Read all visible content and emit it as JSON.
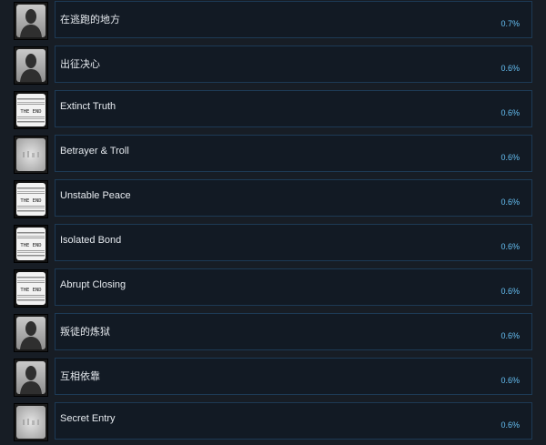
{
  "achievements": [
    {
      "name": "在逃跑的地方",
      "percent": "0.7%",
      "icon": "silhouette-icon"
    },
    {
      "name": "出征决心",
      "percent": "0.6%",
      "icon": "silhouette-icon"
    },
    {
      "name": "Extinct Truth",
      "percent": "0.6%",
      "icon": "the-end-icon",
      "icon_text": "THE END"
    },
    {
      "name": "Betrayer & Troll",
      "percent": "0.6%",
      "icon": "blurred-grey-icon"
    },
    {
      "name": "Unstable Peace",
      "percent": "0.6%",
      "icon": "the-end-icon",
      "icon_text": "THE END"
    },
    {
      "name": "Isolated Bond",
      "percent": "0.6%",
      "icon": "the-end-icon",
      "icon_text": "THE END"
    },
    {
      "name": "Abrupt Closing",
      "percent": "0.6%",
      "icon": "the-end-icon",
      "icon_text": "THE END"
    },
    {
      "name": "叛徒的炼狱",
      "percent": "0.6%",
      "icon": "silhouette-icon"
    },
    {
      "name": "互相依靠",
      "percent": "0.6%",
      "icon": "silhouette-icon"
    },
    {
      "name": "Secret Entry",
      "percent": "0.6%",
      "icon": "blurred-grey-icon"
    }
  ],
  "colors": {
    "background": "#171d25",
    "panel": "#121a24",
    "panel_border": "#1d3a55",
    "percent_text": "#66c0f4",
    "name_text": "#e6eaef"
  }
}
